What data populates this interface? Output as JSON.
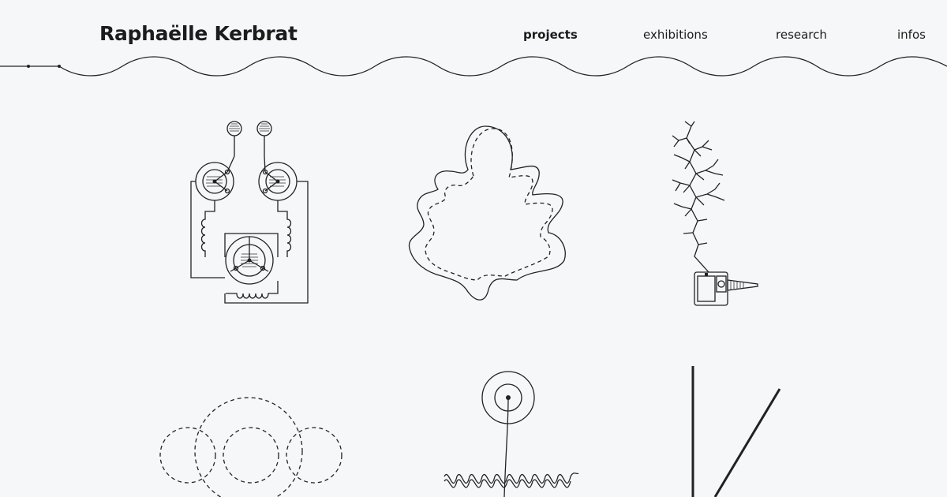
{
  "header": {
    "site_title": "Raphaëlle Kerbrat"
  },
  "nav": {
    "items": [
      {
        "label": "projects",
        "active": true
      },
      {
        "label": "exhibitions",
        "active": false
      },
      {
        "label": "research",
        "active": false
      },
      {
        "label": "infos",
        "active": false
      }
    ]
  },
  "projects": [
    {
      "icon": "circuit-face-icon"
    },
    {
      "icon": "leaf-outline-icon"
    },
    {
      "icon": "branching-plant-device-icon"
    },
    {
      "icon": "dashed-circles-icon"
    },
    {
      "icon": "flower-wave-icon"
    },
    {
      "icon": "lines-icon"
    }
  ],
  "colors": {
    "background": "#f6f7f9",
    "ink": "#1c1c1c"
  }
}
